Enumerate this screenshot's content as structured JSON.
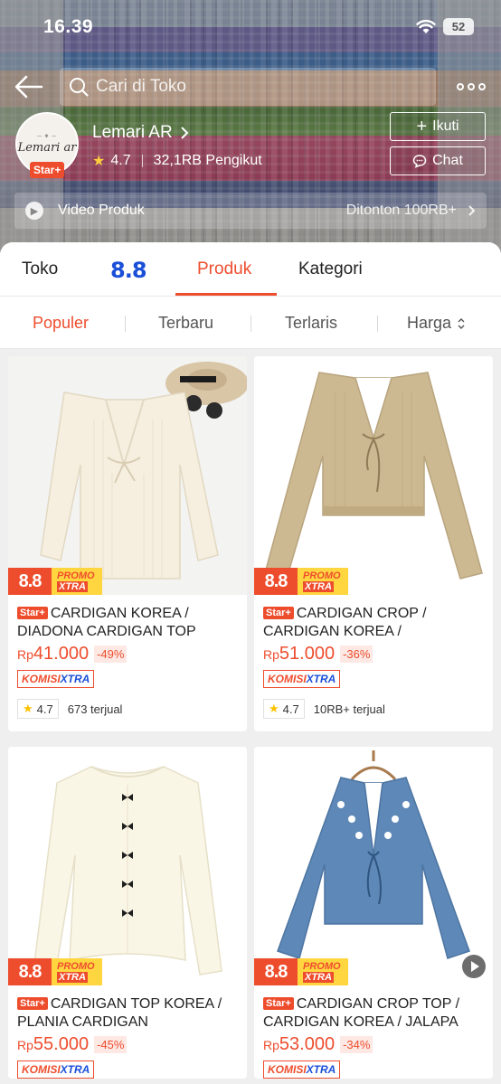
{
  "status": {
    "time": "16.39",
    "battery": "52"
  },
  "header": {
    "search_placeholder": "Cari di Toko",
    "shop": {
      "name": "Lemari AR",
      "badge": "Star+",
      "rating": "4.7",
      "followers": "32,1RB Pengikut",
      "logo_text": "Lemari ar"
    },
    "follow_label": "Ikuti",
    "chat_label": "Chat",
    "video_label": "Video Produk",
    "watched_label": "Ditonton 100RB+"
  },
  "tabs": {
    "toko": "Toko",
    "produk": "Produk",
    "kategori": "Kategori",
    "logo": "8.8"
  },
  "sort": {
    "populer": "Populer",
    "terbaru": "Terbaru",
    "terlaris": "Terlaris",
    "harga": "Harga"
  },
  "promo": {
    "big": "8.8",
    "line1": "PROMO",
    "line2": "XTRA"
  },
  "komisi": {
    "a": "KOMISI",
    "b": "XTRA"
  },
  "products": [
    {
      "badge": "Star+",
      "title": "CARDIGAN KOREA / DIADONA CARDIGAN TOP",
      "currency": "Rp",
      "price": "41.000",
      "discount": "-49%",
      "rating": "4.7",
      "sold": "673 terjual"
    },
    {
      "badge": "Star+",
      "title": "CARDIGAN CROP / CARDIGAN KOREA / CRISTATA...",
      "currency": "Rp",
      "price": "51.000",
      "discount": "-36%",
      "rating": "4.7",
      "sold": "10RB+ terjual"
    },
    {
      "badge": "Star+",
      "title": "CARDIGAN TOP KOREA / PLANIA CARDIGAN",
      "currency": "Rp",
      "price": "55.000",
      "discount": "-45%",
      "rating": "",
      "sold": ""
    },
    {
      "badge": "Star+",
      "title": "CARDIGAN CROP TOP / CARDIGAN KOREA / JALAPA C...",
      "currency": "Rp",
      "price": "53.000",
      "discount": "-34%",
      "rating": "",
      "sold": ""
    }
  ],
  "colors": {
    "accent": "#ee4d2d",
    "brand_blue": "#1a4fd8",
    "promo_yellow": "#ffd640"
  }
}
